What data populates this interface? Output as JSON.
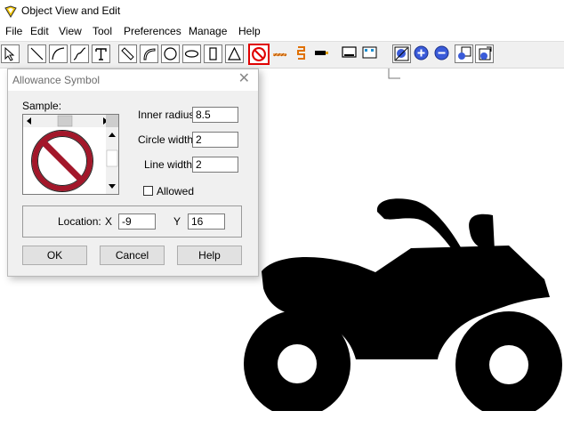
{
  "window": {
    "title": "Object View and Edit"
  },
  "menu": {
    "items": [
      "File",
      "Edit",
      "View",
      "Tool",
      "Preferences",
      "Manage",
      "Help"
    ]
  },
  "toolbar": {
    "tools": [
      "select-arrow-icon",
      "line-icon",
      "arc-icon",
      "curve-icon",
      "text-tool-icon",
      "diagonal-rect-icon",
      "arc2-icon",
      "circle-icon",
      "ellipse-icon",
      "rectangle-icon",
      "triangle-icon",
      "allowance-symbol-icon",
      "hatch-icon",
      "spring-icon",
      "arrow-marker-icon",
      "screen-icon",
      "grid-icon",
      "zoom-fit-icon",
      "zoom-in-icon",
      "zoom-out-icon",
      "zoom-box-icon",
      "zoom-extents-icon"
    ],
    "active_tool": "allowance-symbol-icon"
  },
  "dialog": {
    "title": "Allowance Symbol",
    "sample_label": "Sample:",
    "inner_radius_label": "Inner radius",
    "inner_radius_value": "8.5",
    "circle_width_label": "Circle width",
    "circle_width_value": "2",
    "line_width_label": "Line width",
    "line_width_value": "2",
    "allowed_label": "Allowed",
    "allowed_checked": false,
    "location_label": "Location:",
    "x_label": "X",
    "x_value": "-9",
    "y_label": "Y",
    "y_value": "16",
    "ok_label": "OK",
    "cancel_label": "Cancel",
    "help_label": "Help"
  },
  "colors": {
    "symbol_red": "#a3172a",
    "active_border": "#e00000",
    "zoom_blue": "#3a5bd9"
  }
}
